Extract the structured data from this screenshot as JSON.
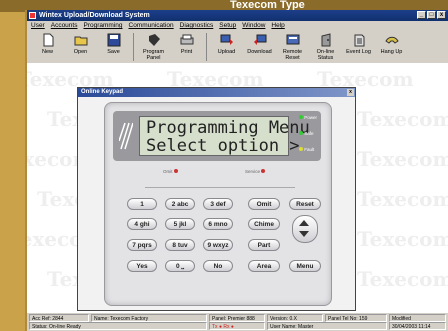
{
  "brand_header": "Texecom Type",
  "window": {
    "title": "Wintex Upload/Download System",
    "buttons": [
      "_",
      "□",
      "x"
    ]
  },
  "menu": [
    "User",
    "Accounts",
    "Programming",
    "Communication",
    "Diagnostics",
    "Setup",
    "Window",
    "Help"
  ],
  "toolbar": [
    {
      "label": "New",
      "icon": "new-document-icon"
    },
    {
      "label": "Open",
      "icon": "folder-icon"
    },
    {
      "label": "Save",
      "icon": "save-icon"
    },
    {
      "label": "Program Panel",
      "icon": "program-panel-icon"
    },
    {
      "label": "Print",
      "icon": "printer-icon"
    },
    {
      "label": "Upload",
      "icon": "upload-icon"
    },
    {
      "label": "Download",
      "icon": "download-icon"
    },
    {
      "label": "Remote Reset",
      "icon": "remote-reset-icon"
    },
    {
      "label": "On-line Status",
      "icon": "online-status-icon"
    },
    {
      "label": "Event Log",
      "icon": "event-log-icon"
    },
    {
      "label": "Hang Up",
      "icon": "hang-up-icon"
    }
  ],
  "watermark_text": "Texecom",
  "dialog": {
    "title": "Online Keypad",
    "close": "x",
    "lcd_line1": "Programming Menu",
    "lcd_line2": "Select option >",
    "indicators": [
      "Power",
      "Safe",
      "Fault"
    ],
    "status_left": "Omit",
    "status_right": "Service",
    "keys": [
      "1",
      "2 abc",
      "3 def",
      "Omit",
      "Reset",
      "4 ghi",
      "5 jkl",
      "6 mno",
      "Chime",
      "7 pqrs",
      "8 tuv",
      "9 wxyz",
      "Part",
      "Yes",
      "0 ⎵",
      "No",
      "Area",
      "Menu"
    ]
  },
  "status": {
    "acc_ref": "Acc Ref: 2844",
    "name": "Name: Texecom Factory",
    "panel": "Panel: Premier 888",
    "version": "Version: 0.X",
    "panel_tel": "Panel Tel No: 159",
    "modified": "Modified",
    "status": "Status: On-line Ready",
    "tx_rx": "Tx ● Rx ●",
    "user": "User Name: Master",
    "datetime": "30/04/2003 11:14"
  },
  "colors": {
    "gold": "#c9a24a",
    "titlebar": "#1d3f8a",
    "lcd": "#d6dfcc"
  }
}
